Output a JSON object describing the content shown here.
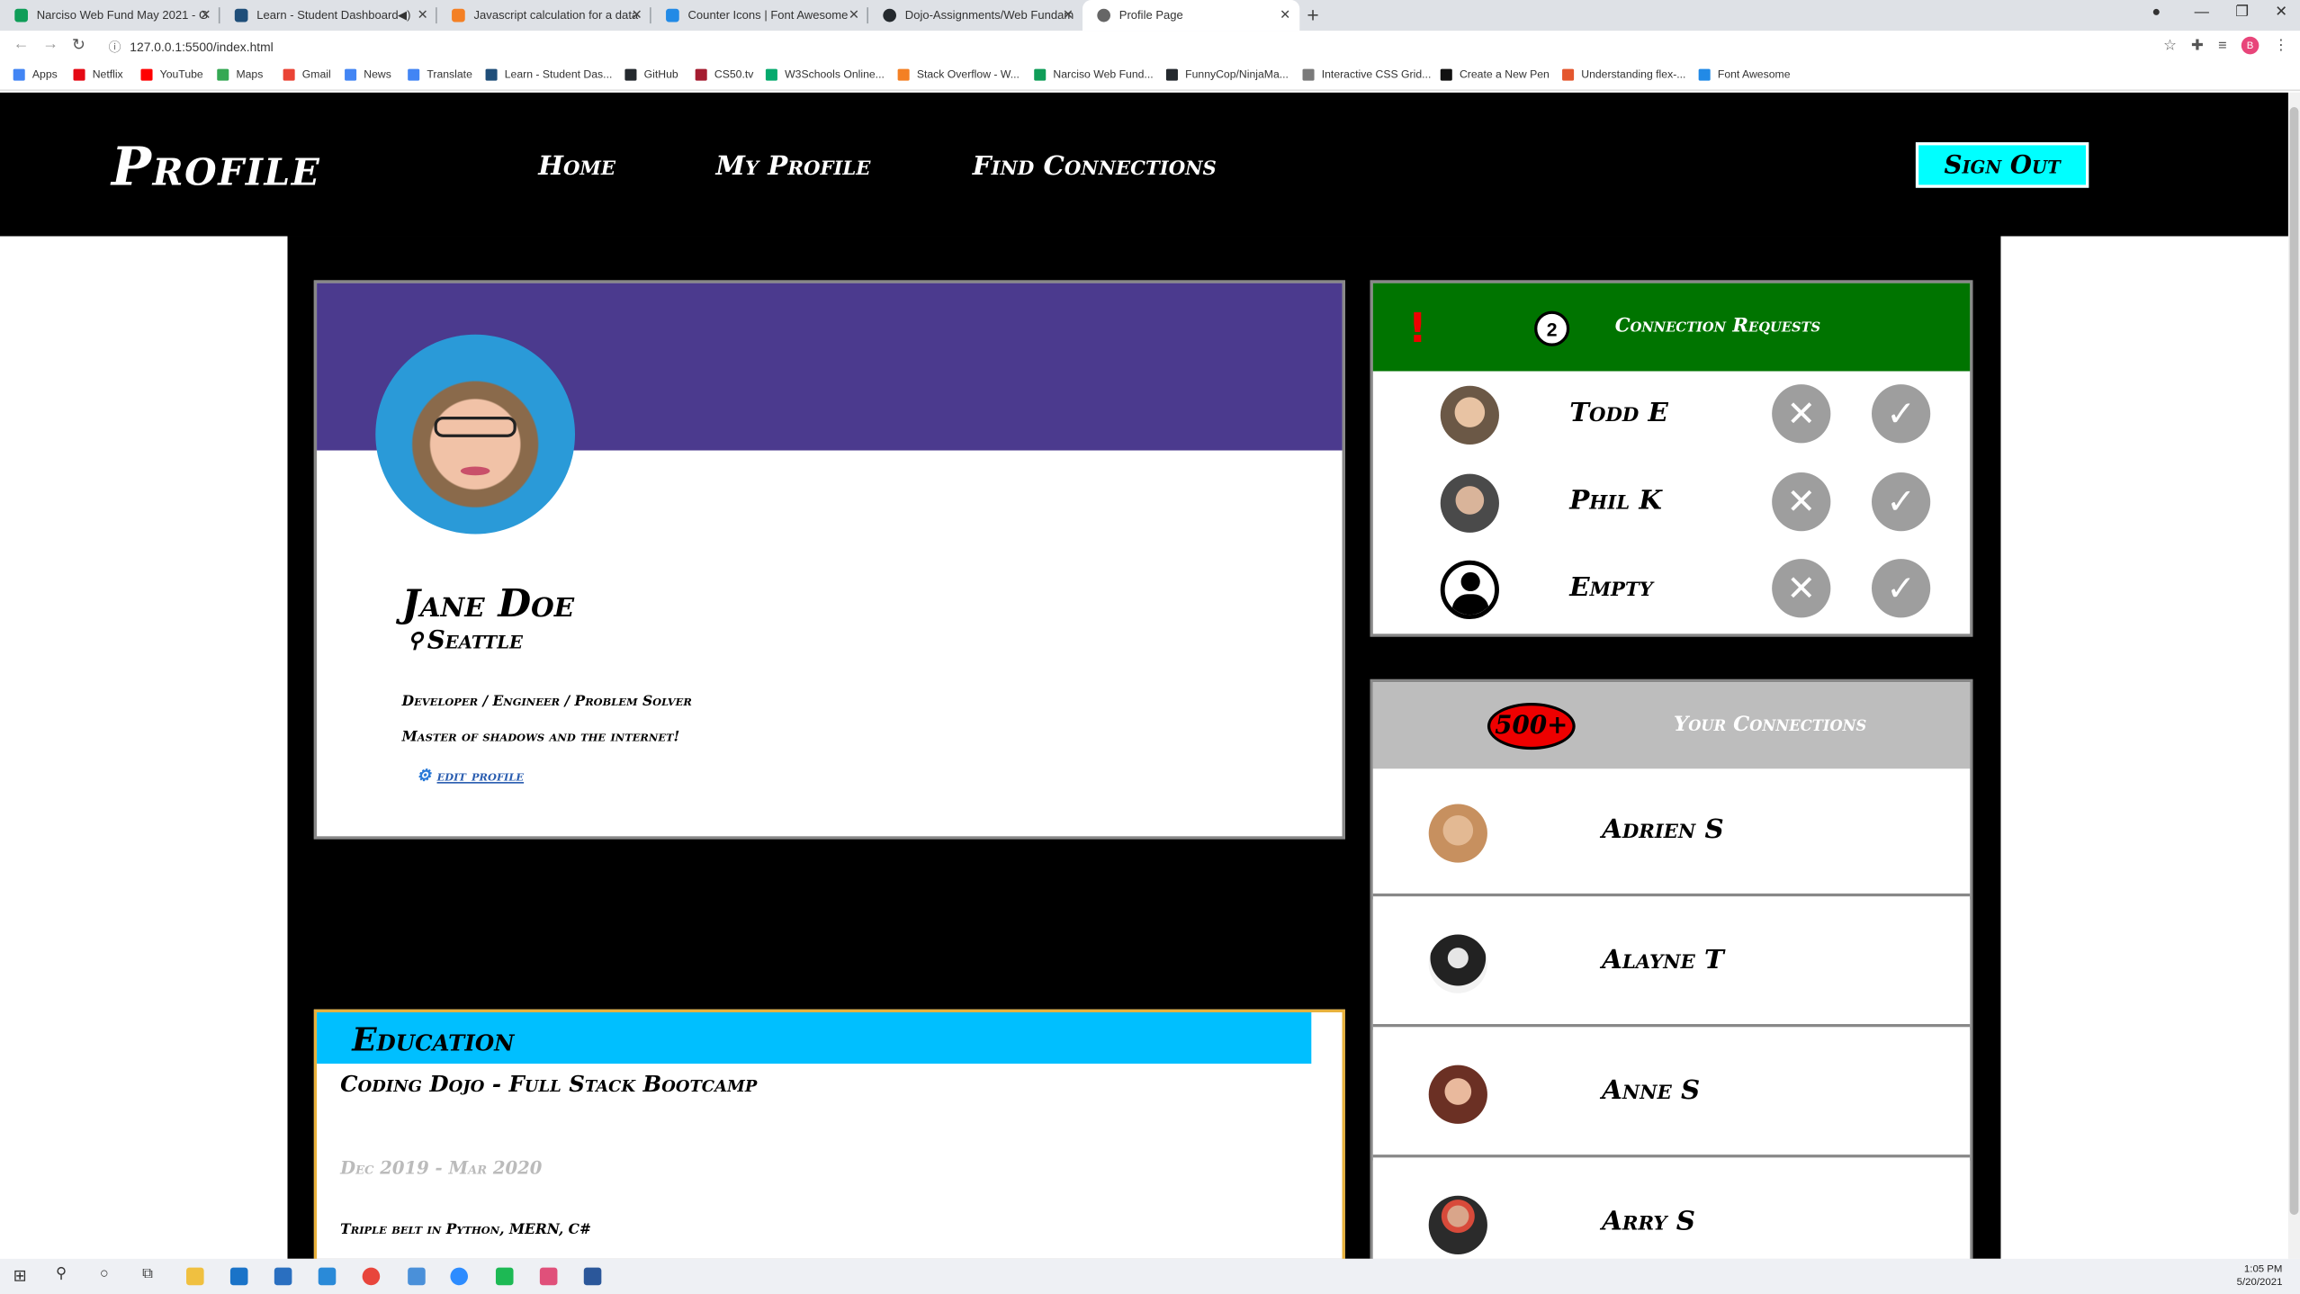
{
  "browser": {
    "tabs": [
      {
        "label": "Narciso Web Fund May 2021 - G",
        "color": "#0f9d58"
      },
      {
        "label": "Learn - Student Dashboard",
        "color": "#1f4e79"
      },
      {
        "label": "Javascript calculation for a data",
        "color": "#f48024"
      },
      {
        "label": "Counter Icons | Font Awesome",
        "color": "#228ae6"
      },
      {
        "label": "Dojo-Assignments/Web Fundam",
        "color": "#24292e"
      },
      {
        "label": "Profile Page",
        "color": "#666666"
      }
    ],
    "url": "127.0.0.1:5500/index.html",
    "profile_initial": "B",
    "bookmarks": [
      {
        "label": "Apps",
        "color": "#4285f4"
      },
      {
        "label": "Netflix",
        "color": "#e50914"
      },
      {
        "label": "YouTube",
        "color": "#ff0000"
      },
      {
        "label": "Maps",
        "color": "#34a853"
      },
      {
        "label": "Gmail",
        "color": "#ea4335"
      },
      {
        "label": "News",
        "color": "#4285f4"
      },
      {
        "label": "Translate",
        "color": "#4285f4"
      },
      {
        "label": "Learn - Student Das...",
        "color": "#1f4e79"
      },
      {
        "label": "GitHub",
        "color": "#24292e"
      },
      {
        "label": "CS50.tv",
        "color": "#a51c30"
      },
      {
        "label": "W3Schools Online...",
        "color": "#04aa6d"
      },
      {
        "label": "Stack Overflow - W...",
        "color": "#f48024"
      },
      {
        "label": "Narciso Web Fund...",
        "color": "#0f9d58"
      },
      {
        "label": "FunnyCop/NinjaMa...",
        "color": "#24292e"
      },
      {
        "label": "Interactive CSS Grid...",
        "color": "#7a7a7a"
      },
      {
        "label": "Create a New Pen",
        "color": "#111111"
      },
      {
        "label": "Understanding flex-...",
        "color": "#e4572e"
      },
      {
        "label": "Font Awesome",
        "color": "#228ae6"
      }
    ]
  },
  "header": {
    "logo": "Profile",
    "nav": [
      "Home",
      "My Profile",
      "Find Connections"
    ],
    "signout": "Sign Out"
  },
  "profile": {
    "name": "Jane Doe",
    "location": "Seattle",
    "tagline": "Developer / Engineer / Problem Solver",
    "bio": "Master of shadows and the internet!",
    "edit": "edit profile",
    "banner_color": "#4b3a8e"
  },
  "education": {
    "title": "Education",
    "school": "Coding Dojo - Full Stack Bootcamp",
    "dates": "Dec 2019 - Mar 2020",
    "desc": "Triple belt in Python, MERN, C#"
  },
  "requests": {
    "count": "2",
    "title": "Connection Requests",
    "items": [
      {
        "name": "Todd E"
      },
      {
        "name": "Phil K"
      },
      {
        "name": "Empty"
      }
    ]
  },
  "connections": {
    "count": "500+",
    "title": "Your Connections",
    "items": [
      {
        "name": "Adrien S"
      },
      {
        "name": "Alayne T"
      },
      {
        "name": "Anne S"
      },
      {
        "name": "Arry S"
      }
    ]
  },
  "taskbar": {
    "time": "1:05 PM",
    "date": "5/20/2021"
  }
}
